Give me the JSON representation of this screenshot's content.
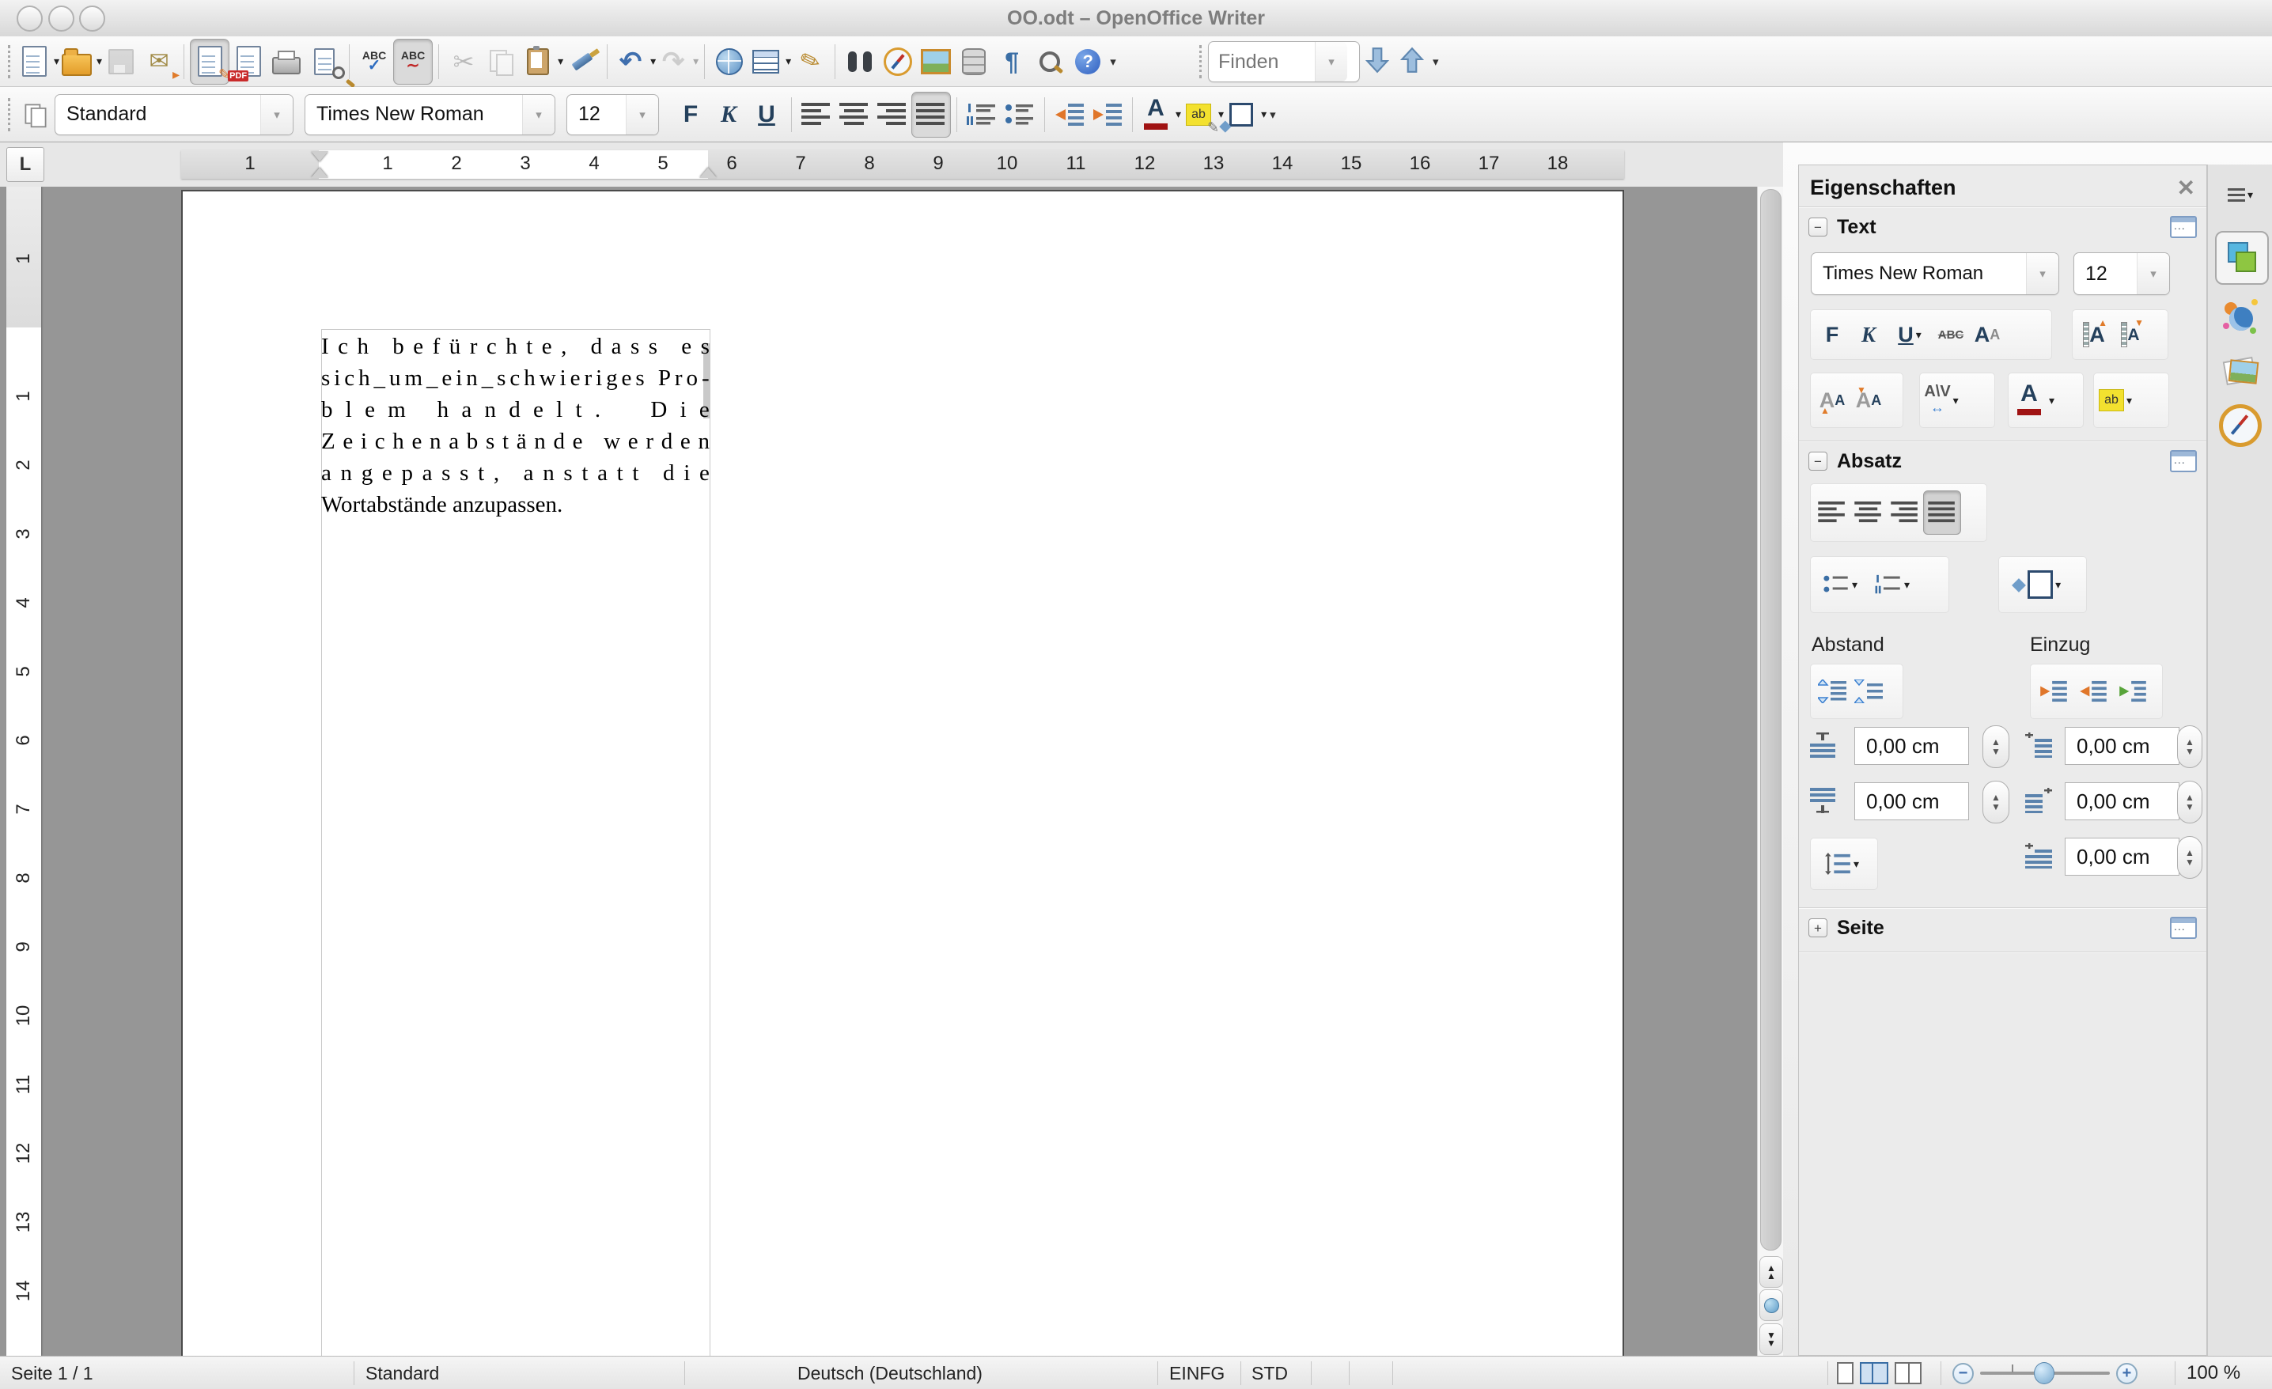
{
  "window": {
    "title": "OO.odt – OpenOffice Writer"
  },
  "toolbar_main": {
    "icons": [
      "new-document",
      "open",
      "save",
      "email-document",
      "edit-file",
      "export-pdf",
      "print",
      "page-preview",
      "spellcheck",
      "auto-spellcheck",
      "cut",
      "copy",
      "paste",
      "format-paintbrush",
      "undo",
      "redo",
      "hyperlink",
      "insert-table",
      "draw-functions",
      "find-replace",
      "navigator",
      "gallery",
      "data-sources",
      "formatting-marks",
      "zoom",
      "help",
      "toolbar-overflow"
    ],
    "abc_label": "ABC",
    "pdf_label": "PDF",
    "find": {
      "placeholder": "Finden"
    }
  },
  "toolbar_format": {
    "paragraph_style": "Standard",
    "font_name": "Times New Roman",
    "font_size": "12",
    "bold": "F",
    "italic": "K",
    "underline": "U"
  },
  "ruler": {
    "tab_selector": "L",
    "h_margin_left_numbers": [
      "1"
    ],
    "h_text_numbers": [
      "1",
      "2",
      "3",
      "4",
      "5"
    ],
    "h_right_numbers": [
      "6",
      "7",
      "8",
      "9",
      "10",
      "11",
      "12",
      "13",
      "14",
      "15",
      "16",
      "17",
      "18"
    ],
    "v_margin_numbers": [
      "1"
    ],
    "v_numbers": [
      "1",
      "2",
      "3",
      "4",
      "5",
      "6",
      "7",
      "8",
      "9",
      "10",
      "11",
      "12",
      "13",
      "14"
    ]
  },
  "document": {
    "paragraph_lines": [
      "Ich befürchte, dass es",
      "sich_um_ein_schwieriges Pro-",
      "blem handelt.  Die",
      "Zeichenabstände werden",
      "angepasst, anstatt die",
      "Wortabstände anzupassen."
    ]
  },
  "sidebar": {
    "title": "Eigenschaften",
    "text_section": {
      "title": "Text",
      "font_name": "Times New Roman",
      "font_size": "12",
      "bold": "F",
      "italic": "K",
      "underline": "U",
      "strikethrough": "ABC"
    },
    "paragraph_section": {
      "title": "Absatz",
      "spacing_label": "Abstand",
      "indent_label": "Einzug",
      "above_spacing": "0,00 cm",
      "below_spacing": "0,00 cm",
      "before_indent": "0,00 cm",
      "after_indent": "0,00 cm",
      "firstline_indent": "0,00 cm"
    },
    "page_section": {
      "title": "Seite"
    },
    "tabs": [
      "properties",
      "styles",
      "gallery",
      "navigator"
    ]
  },
  "statusbar": {
    "page": "Seite 1 / 1",
    "style": "Standard",
    "language": "Deutsch (Deutschland)",
    "insert_mode": "EINFG",
    "selection_mode": "STD",
    "zoom": "100 %"
  }
}
